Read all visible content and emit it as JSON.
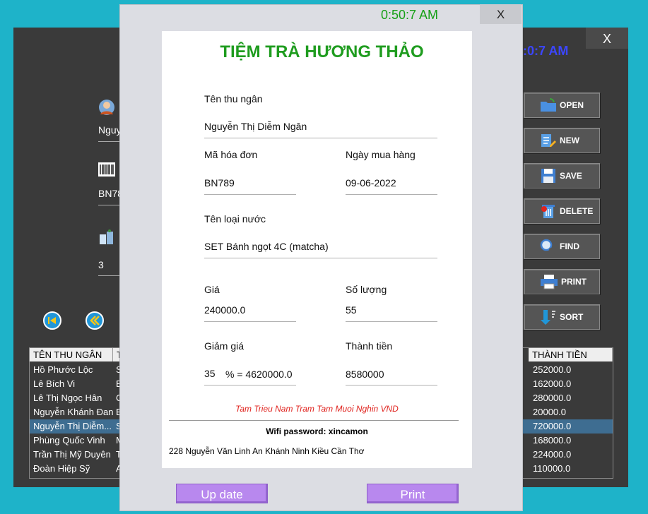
{
  "main_window": {
    "close": "X",
    "clock_partial": ":0:7 AM",
    "cashier_partial": "Nguy",
    "bill_partial": "BN78",
    "qty_value": "3",
    "side_buttons": [
      "OPEN",
      "NEW",
      "SAVE",
      "DELETE",
      "FIND",
      "PRINT",
      "SORT"
    ],
    "table": {
      "col1_header": "TÊN THU NGÂN",
      "col2_header": "T",
      "col3_header": "THÀNH TIỀN",
      "rows": [
        {
          "name": "Hồ Phước Lộc",
          "c2": "S",
          "total": "252000.0"
        },
        {
          "name": "Lê Bích Vi",
          "c2": "B",
          "total": "162000.0"
        },
        {
          "name": "Lê Thị Ngọc Hân",
          "c2": "C",
          "total": "280000.0"
        },
        {
          "name": "Nguyễn Khánh Đan",
          "c2": "B",
          "total": "20000.0"
        },
        {
          "name": "Nguyễn Thị Diễm...",
          "c2": "S",
          "total": "720000.0"
        },
        {
          "name": "Phùng Quốc Vinh",
          "c2": "M",
          "total": "168000.0"
        },
        {
          "name": "Trần Thị Mỹ Duyên",
          "c2": "T",
          "total": "224000.0"
        },
        {
          "name": "Đoàn Hiệp Sỹ",
          "c2": "A",
          "total": "110000.0"
        }
      ],
      "selected_index": 4
    }
  },
  "dialog": {
    "clock": "0:50:7 AM",
    "close": "X",
    "shop_name": "TIỆM TRÀ HƯƠNG THẢO",
    "cashier_label": "Tên thu ngân",
    "cashier_value": "Nguyễn Thị Diễm Ngân",
    "bill_label": "Mã hóa đơn",
    "bill_value": "BN789",
    "date_label": "Ngày mua hàng",
    "date_value": "09-06-2022",
    "drink_label": "Tên loại nước",
    "drink_value": "SET Bánh ngọt 4C (matcha)",
    "price_label": "Giá",
    "price_value": "240000.0",
    "qty_label": "Số lượng",
    "qty_value": "55",
    "discount_label": "Giảm giá",
    "discount_value": "35",
    "discount_eq": "% =  4620000.0",
    "total_label": "Thành tiền",
    "total_value": "8580000",
    "amount_words": "Tam Trieu Nam Tram Tam Muoi Nghin VND",
    "wifi": "Wifi password: xincamon",
    "address": "228 Nguyễn Văn Linh An Khánh Ninh Kiều Cần Thơ",
    "update_button": "Up date",
    "print_button": "Print"
  },
  "colors": {
    "desktop": "#1eb3c9",
    "shop_name": "#1f9c1f",
    "amount_words": "#e0241f",
    "dialog_button": "#b888ee"
  }
}
